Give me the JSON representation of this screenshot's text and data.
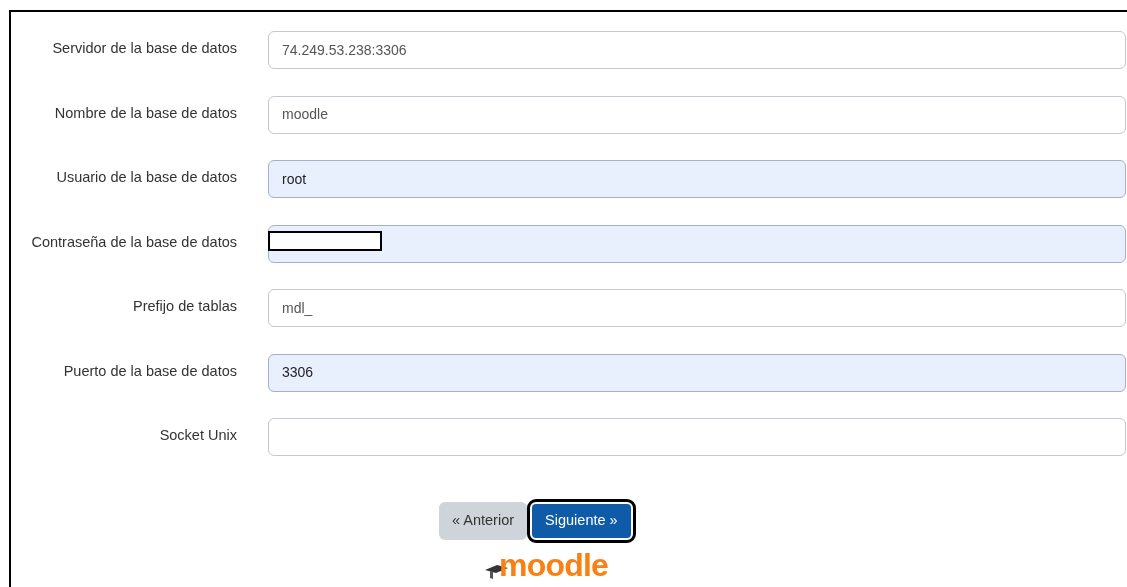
{
  "fields": [
    {
      "label": "Servidor de la base de datos",
      "value": "74.249.53.238:3306",
      "autofilled": false,
      "redacted": false
    },
    {
      "label": "Nombre de la base de datos",
      "value": "moodle",
      "autofilled": false,
      "redacted": false
    },
    {
      "label": "Usuario de la base de datos",
      "value": "root",
      "autofilled": true,
      "redacted": false
    },
    {
      "label": "Contraseña de la base de datos",
      "autofilled": true,
      "redacted": true
    },
    {
      "label": "Prefijo de tablas",
      "value": "mdl_",
      "autofilled": false,
      "redacted": false
    },
    {
      "label": "Puerto de la base de datos",
      "value": "3306",
      "autofilled": true,
      "redacted": false
    },
    {
      "label": "Socket Unix",
      "autofilled": false,
      "redacted": false
    }
  ],
  "buttons": [
    {
      "label": "« Anterior",
      "kind": "secondary",
      "focused": false
    },
    {
      "label": "Siguiente »",
      "kind": "primary",
      "focused": true
    }
  ],
  "logo": {
    "text": "moodle"
  }
}
